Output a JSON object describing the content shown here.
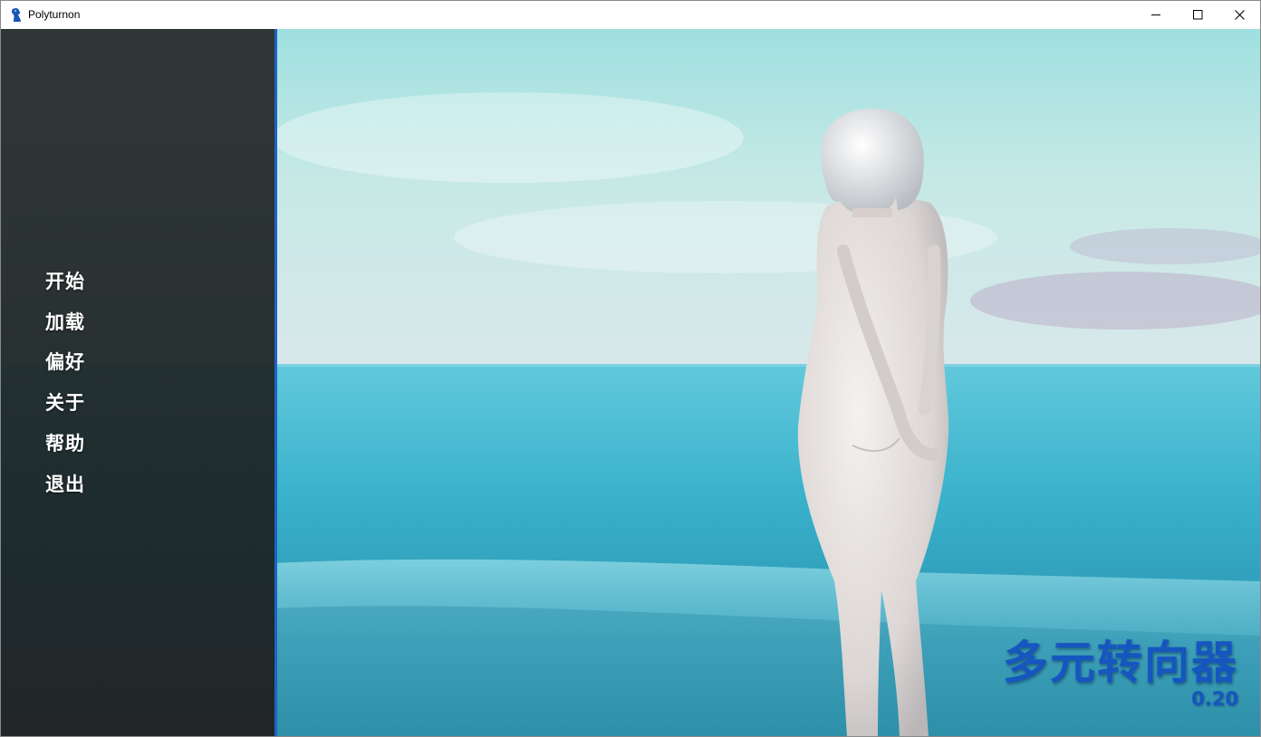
{
  "window": {
    "title": "Polyturnon"
  },
  "menu": {
    "items": [
      {
        "label": "开始"
      },
      {
        "label": "加载"
      },
      {
        "label": "偏好"
      },
      {
        "label": "关于"
      },
      {
        "label": "帮助"
      },
      {
        "label": "退出"
      }
    ]
  },
  "game": {
    "title": "多元转向器",
    "version": "0.20"
  },
  "icons": {
    "app": "app-icon",
    "minimize": "minimize-icon",
    "maximize": "maximize-icon",
    "close": "close-icon"
  },
  "colors": {
    "accent": "#1d63c4",
    "title_text": "#1556c0",
    "panel": "#222a2b"
  }
}
